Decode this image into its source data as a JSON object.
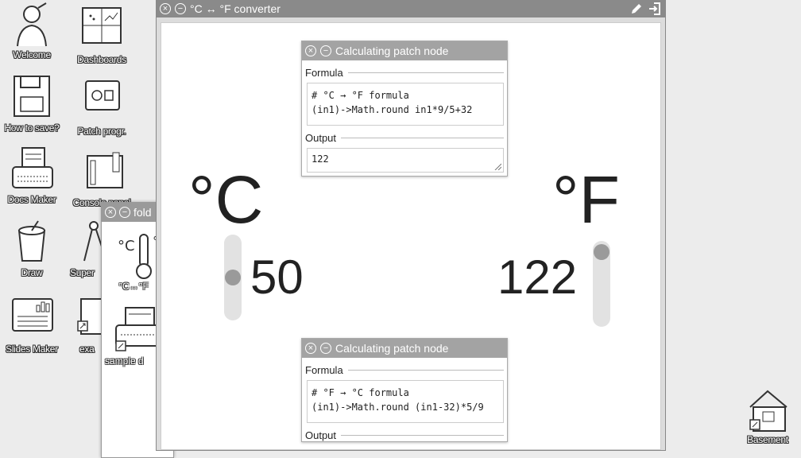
{
  "desktop": {
    "icons": [
      {
        "label": "Welcome"
      },
      {
        "label": "Dashboards"
      },
      {
        "label": "How to save?"
      },
      {
        "label": "Patch progr."
      },
      {
        "label": "Docs Maker"
      },
      {
        "label": "Console panel"
      },
      {
        "label": "Draw"
      },
      {
        "label": "Super"
      },
      {
        "label": "Slides Maker"
      },
      {
        "label": "exa"
      },
      {
        "label": "Basement"
      }
    ]
  },
  "folder_window": {
    "title": "fold",
    "items": [
      {
        "label": "°C↔°F"
      },
      {
        "label": "sample d"
      }
    ]
  },
  "main_window": {
    "title": "°C ↔ °F converter",
    "celsius": {
      "unit": "°C",
      "value": "50",
      "slider_level": 0.5
    },
    "fahrenheit": {
      "unit": "°F",
      "value": "122",
      "slider_level": 0.05
    }
  },
  "node_top": {
    "title": "Calculating patch node",
    "formula_label": "Formula",
    "formula_line1": "# °C → °F formula",
    "formula_line2": "(in1)->Math.round in1*9/5+32",
    "output_label": "Output",
    "output_value": "122"
  },
  "node_bottom": {
    "title": "Calculating patch node",
    "formula_label": "Formula",
    "formula_line1": "# °F → °C formula",
    "formula_line2": "(in1)->Math.round (in1-32)*5/9",
    "output_label": "Output"
  },
  "icons": {
    "close": "⊗",
    "minimize": "⊖",
    "edit": "pencil-icon",
    "exit": "exit-icon"
  },
  "colors": {
    "titlebar": "#8a8a8a",
    "node_titlebar": "#a3a3a3",
    "slider_knob": "#9a9a9a",
    "slider_track": "#e2e2e2"
  }
}
